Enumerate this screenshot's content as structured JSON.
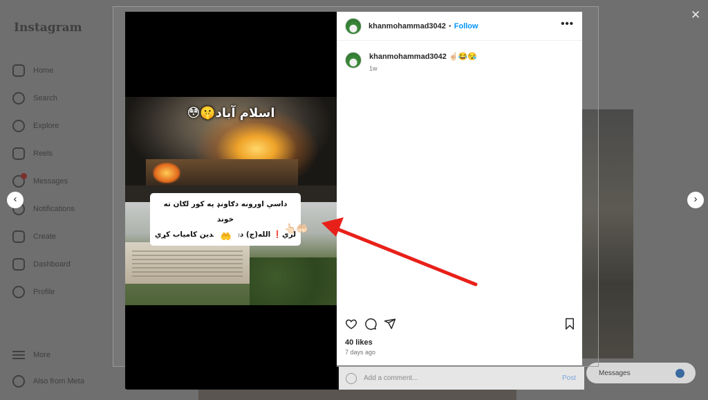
{
  "app": {
    "logo": "Instagram"
  },
  "sidebar": {
    "items": [
      {
        "label": "Home",
        "icon": "home-icon"
      },
      {
        "label": "Search",
        "icon": "search-icon"
      },
      {
        "label": "Explore",
        "icon": "compass-icon"
      },
      {
        "label": "Reels",
        "icon": "reels-icon"
      },
      {
        "label": "Messages",
        "icon": "messenger-icon"
      },
      {
        "label": "Notifications",
        "icon": "heart-icon"
      },
      {
        "label": "Create",
        "icon": "plus-square-icon"
      },
      {
        "label": "Dashboard",
        "icon": "dashboard-icon"
      },
      {
        "label": "Profile",
        "icon": "avatar-icon"
      }
    ],
    "bottom": [
      {
        "label": "More",
        "icon": "menu-icon"
      },
      {
        "label": "Also from Meta",
        "icon": "meta-icon"
      }
    ]
  },
  "post": {
    "username": "khanmohammad3042",
    "separator": "•",
    "follow_label": "Follow",
    "more_label": "•••",
    "caption_emoji": "☝🏻😂😪",
    "caption_time": "1w",
    "likes": "40 likes",
    "age": "7 days ago",
    "media": {
      "title_text": "اسلام آباد🤫😳",
      "overlay_line1": "داسې اورونه دګاونډ په کور لګان ته خوند",
      "overlay_line2": "لري❗ الله(ج) دې مجاهدین کامیاب کړي",
      "overlay_emoji": "🤲",
      "side_emoji": "👆🏻🤲🏻"
    }
  },
  "comment_bar": {
    "placeholder": "Add a comment...",
    "post_label": "Post"
  },
  "messages_bar": {
    "label": "Messages"
  },
  "controls": {
    "close": "✕",
    "prev": "‹",
    "next": "›"
  },
  "colors": {
    "accent": "#0095f6",
    "annotation_arrow": "#e8201a"
  }
}
